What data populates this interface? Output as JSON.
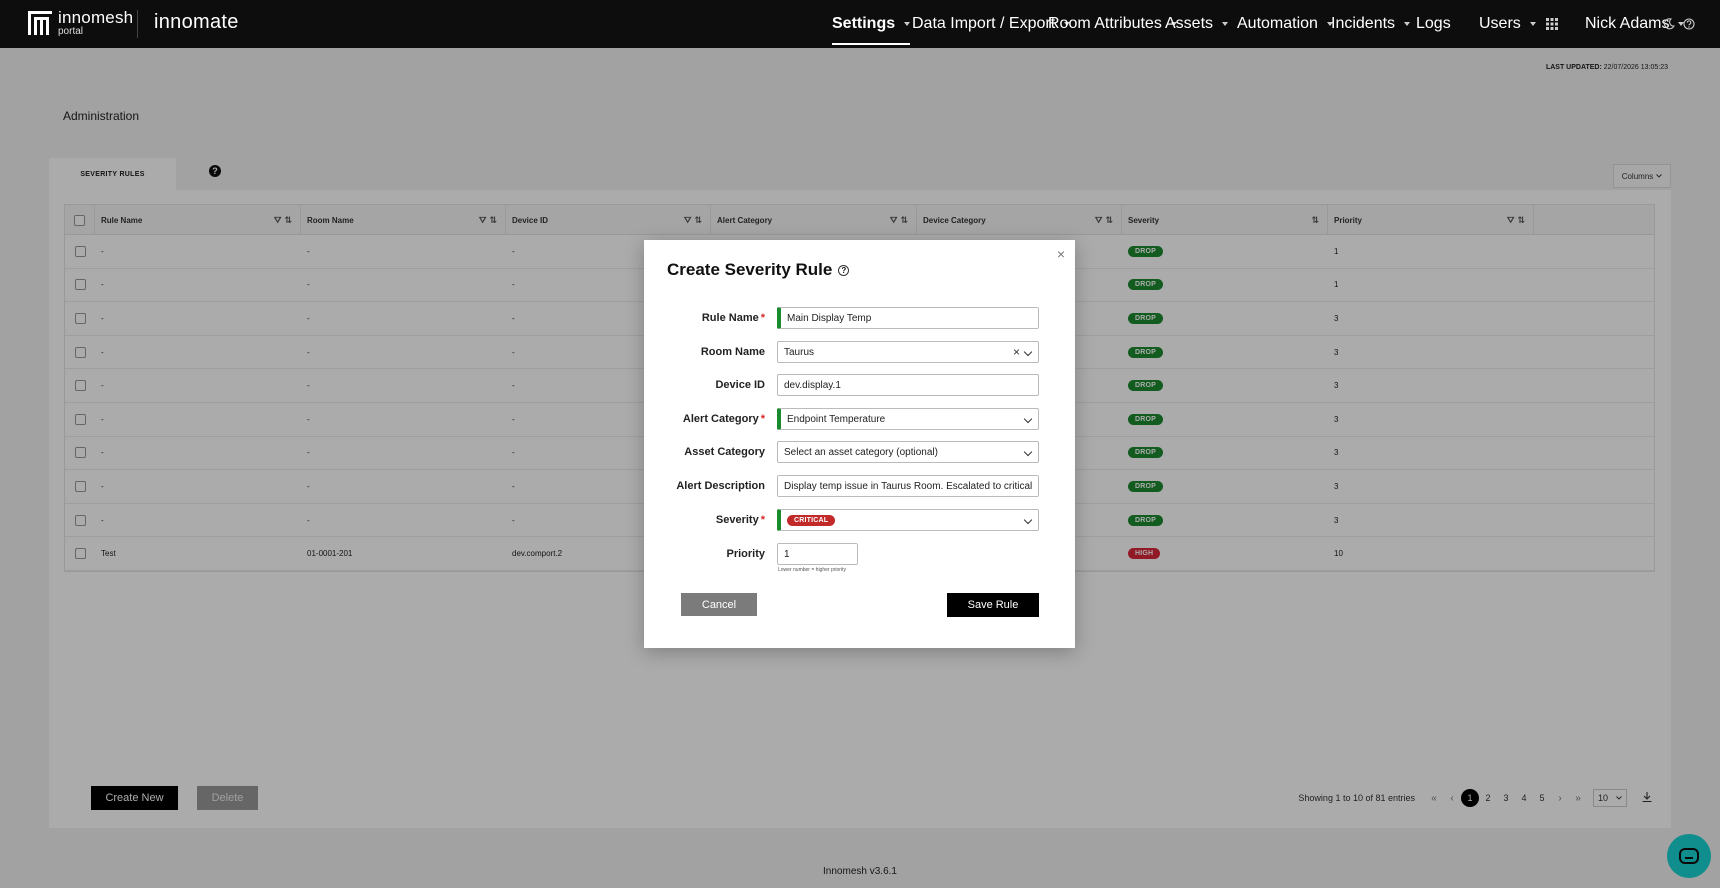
{
  "app": {
    "logo_name": "innomesh",
    "logo_sub": "portal",
    "product": "innomate",
    "version": "Innomesh v3.6.1"
  },
  "nav": {
    "items": [
      {
        "label": "Settings",
        "active": true
      },
      {
        "label": "Data Import / Export"
      },
      {
        "label": "Room Attributes"
      },
      {
        "label": "Assets"
      },
      {
        "label": "Automation"
      },
      {
        "label": "Incidents"
      },
      {
        "label": "Logs"
      },
      {
        "label": "Users"
      }
    ],
    "user_name": "Nick Adams"
  },
  "page": {
    "last_updated_label": "LAST UPDATED:",
    "last_updated_value": "22/07/2026 13:05:23",
    "title": "Administration",
    "tab": "SEVERITY RULES",
    "columns_button": "Columns"
  },
  "table": {
    "headers": [
      "Rule Name",
      "Room Name",
      "Device ID",
      "Alert Category",
      "Device Category",
      "Severity",
      "Priority"
    ],
    "rows": [
      {
        "rule": "-",
        "room": "-",
        "device": "-",
        "severity": "DROP",
        "priority": "1"
      },
      {
        "rule": "-",
        "room": "-",
        "device": "-",
        "severity": "DROP",
        "priority": "1"
      },
      {
        "rule": "-",
        "room": "-",
        "device": "-",
        "severity": "DROP",
        "priority": "3"
      },
      {
        "rule": "-",
        "room": "-",
        "device": "-",
        "severity": "DROP",
        "priority": "3"
      },
      {
        "rule": "-",
        "room": "-",
        "device": "-",
        "severity": "DROP",
        "priority": "3"
      },
      {
        "rule": "-",
        "room": "-",
        "device": "-",
        "severity": "DROP",
        "priority": "3"
      },
      {
        "rule": "-",
        "room": "-",
        "device": "-",
        "severity": "DROP",
        "priority": "3"
      },
      {
        "rule": "-",
        "room": "-",
        "device": "-",
        "severity": "DROP",
        "priority": "3"
      },
      {
        "rule": "-",
        "room": "-",
        "device": "-",
        "severity": "DROP",
        "priority": "3"
      },
      {
        "rule": "Test",
        "room": "01-0001-201",
        "device": "dev.comport.2",
        "severity": "HIGH",
        "priority": "10"
      }
    ]
  },
  "actions": {
    "create_new": "Create New",
    "delete": "Delete"
  },
  "pagination": {
    "info": "Showing 1 to 10 of 81 entries",
    "first": "«",
    "prev": "‹",
    "pages": [
      "1",
      "2",
      "3",
      "4",
      "5"
    ],
    "next": "›",
    "last": "»",
    "page_size": "10"
  },
  "modal": {
    "title": "Create Severity Rule",
    "close": "×",
    "fields": {
      "rule_name_label": "Rule Name",
      "rule_name_value": "Main Display Temp",
      "room_name_label": "Room Name",
      "room_name_value": "Taurus",
      "device_id_label": "Device ID",
      "device_id_value": "dev.display.1",
      "alert_category_label": "Alert Category",
      "alert_category_value": "Endpoint Temperature",
      "asset_category_label": "Asset Category",
      "asset_category_placeholder": "Select an asset category (optional)",
      "alert_description_label": "Alert Description",
      "alert_description_value": "Display temp issue in Taurus Room. Escalated to critical",
      "severity_label": "Severity",
      "severity_value": "CRITICAL",
      "priority_label": "Priority",
      "priority_value": "1",
      "priority_hint": "Lower number = higher priority"
    },
    "cancel": "Cancel",
    "save": "Save Rule"
  },
  "colors": {
    "nav_bg": "#0d0d0d",
    "drop": "#1a8a2e",
    "high": "#d9283a",
    "critical": "#c22a2a",
    "chat": "#18d3d3"
  }
}
